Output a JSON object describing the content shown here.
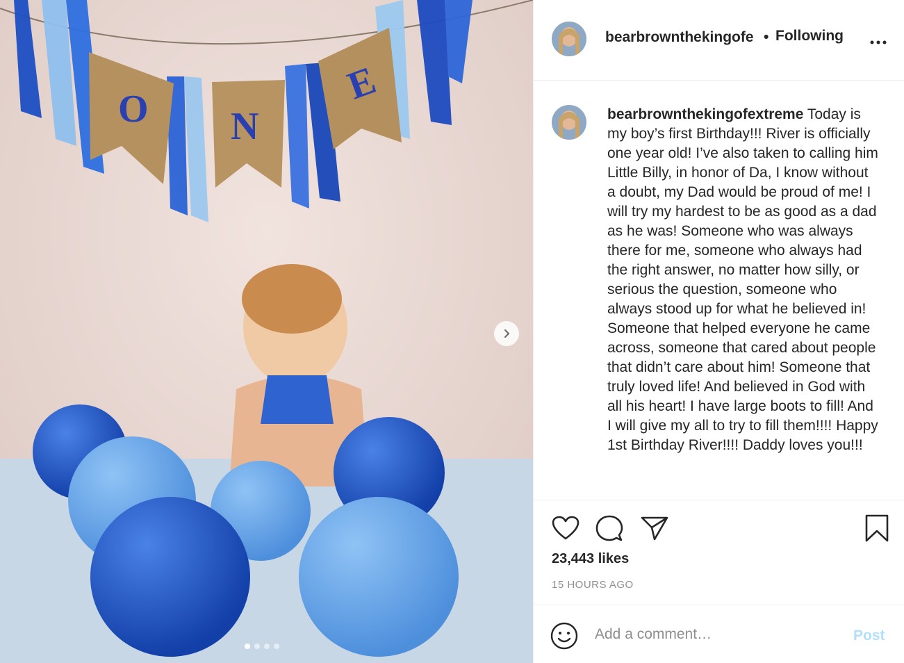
{
  "post": {
    "username_header": "bearbrownthekingofe",
    "separator": "•",
    "follow_status": "Following",
    "more_icon": "more-horizontal-icon",
    "caption_username": "bearbrownthekingofextreme",
    "caption_text": " Today is my boy’s first Birthday!!! River is officially one year old! I’ve also taken to calling him Little Billy, in honor of Da, I know without a doubt, my Dad would be proud of me! I will try my hardest to be as good as a dad as he was! Someone who was always there for me, someone who always had the right answer, no matter how silly, or serious the question, someone who always stood up for what he believed in! Someone that helped everyone he came across, someone that cared about people that didn’t care about him! Someone that truly loved life! And believed in God with all his heart! I have large boots to fill! And I will give my all to try to fill them!!!! Happy 1st Birthday River!!!! Daddy loves you!!!",
    "likes": "23,443 likes",
    "timestamp": "15 HOURS AGO"
  },
  "photo": {
    "banner_letters": [
      "O",
      "N",
      "E"
    ],
    "carousel_count": 4,
    "carousel_active": 1
  },
  "comment": {
    "placeholder": "Add a comment…",
    "post_label": "Post"
  },
  "colors": {
    "post_button_disabled": "#b2dffc",
    "secondary_text": "#8e8e8e"
  }
}
